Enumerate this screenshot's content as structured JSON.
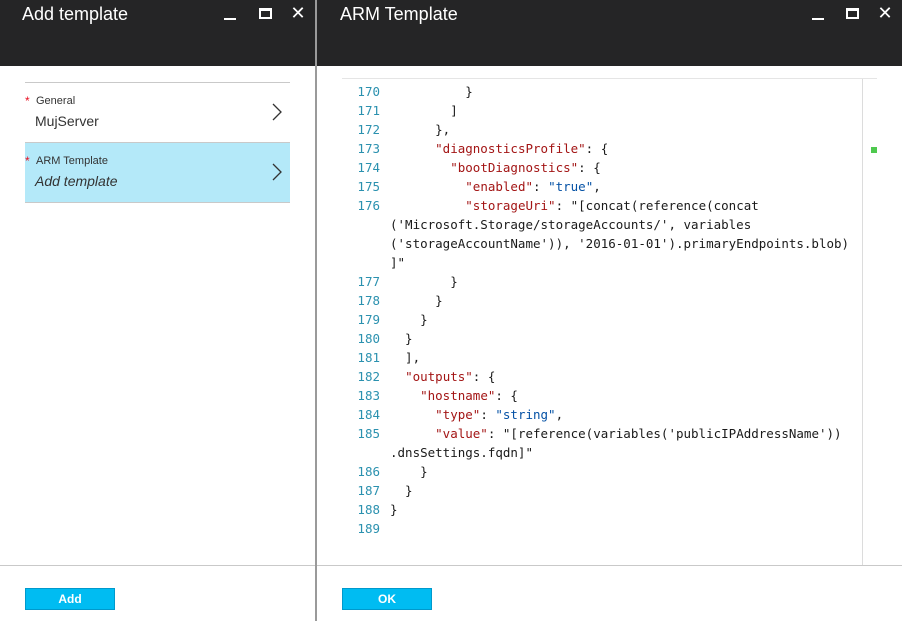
{
  "left_blade": {
    "title": "Add template",
    "steps": [
      {
        "label": "General",
        "value": "MujServer",
        "required": true,
        "selected": false
      },
      {
        "label": "ARM Template",
        "value": "Add template",
        "required": true,
        "selected": true
      }
    ],
    "footer_button": "Add"
  },
  "right_blade": {
    "title": "ARM Template",
    "footer_button": "OK"
  },
  "window_controls": {
    "minimize": "minimize-icon",
    "maximize": "maximize-icon",
    "close": "close-icon"
  },
  "editor": {
    "lines": [
      {
        "n": "170",
        "t": "          }"
      },
      {
        "n": "171",
        "t": "        ]"
      },
      {
        "n": "172",
        "t": "      },"
      },
      {
        "n": "173",
        "t": "      \"diagnosticsProfile\": {"
      },
      {
        "n": "174",
        "t": "        \"bootDiagnostics\": {"
      },
      {
        "n": "175",
        "t": "          \"enabled\": \"true\","
      },
      {
        "n": "176",
        "t": "          \"storageUri\": \"[concat(reference(concat"
      },
      {
        "n": "",
        "t": "('Microsoft.Storage/storageAccounts/', variables"
      },
      {
        "n": "",
        "t": "('storageAccountName')), '2016-01-01').primaryEndpoints.blob)"
      },
      {
        "n": "",
        "t": "]\""
      },
      {
        "n": "177",
        "t": "        }"
      },
      {
        "n": "178",
        "t": "      }"
      },
      {
        "n": "179",
        "t": "    }"
      },
      {
        "n": "180",
        "t": "  }"
      },
      {
        "n": "181",
        "t": "  ],"
      },
      {
        "n": "182",
        "t": "  \"outputs\": {"
      },
      {
        "n": "183",
        "t": "    \"hostname\": {"
      },
      {
        "n": "184",
        "t": "      \"type\": \"string\","
      },
      {
        "n": "185",
        "t": "      \"value\": \"[reference(variables('publicIPAddressName'))"
      },
      {
        "n": "",
        "t": ".dnsSettings.fqdn]\""
      },
      {
        "n": "186",
        "t": "    }"
      },
      {
        "n": "187",
        "t": "  }"
      },
      {
        "n": "188",
        "t": "}"
      },
      {
        "n": "189",
        "t": ""
      }
    ]
  },
  "colors": {
    "header": "#252526",
    "accent": "#00bcf2",
    "selected_step": "#b4e9f9",
    "line_number": "#2b91af"
  }
}
